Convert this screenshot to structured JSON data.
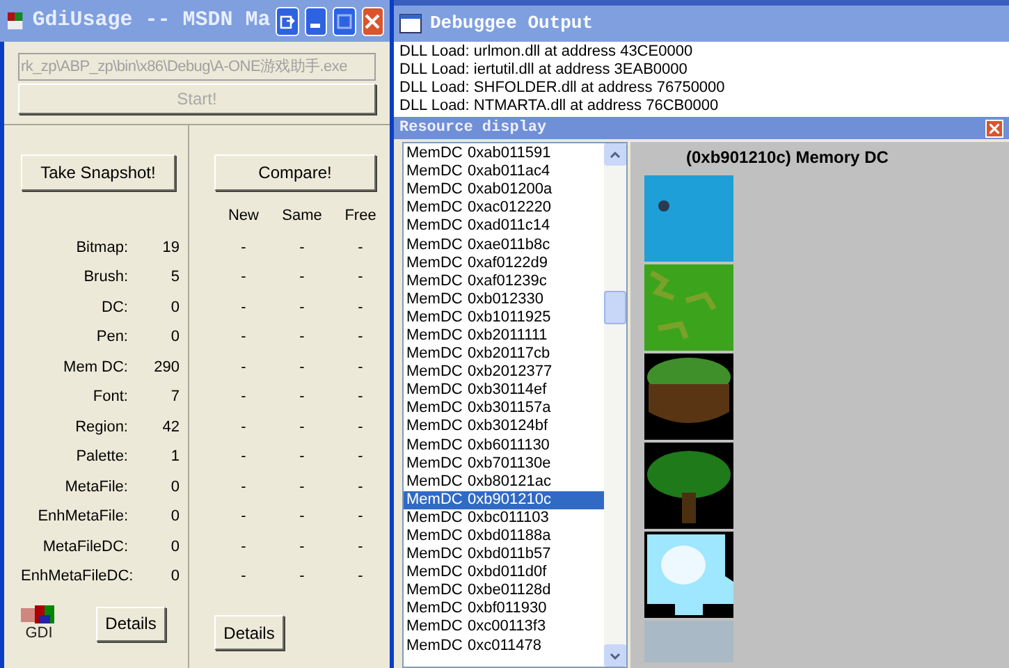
{
  "main_window": {
    "title": "GdiUsage -- MSDN Ma",
    "path_field": {
      "value": "rk_zp\\ABP_zp\\bin\\x86\\Debug\\A-ONE游戏助手.exe",
      "disabled": true
    },
    "start_button": {
      "label": "Start!",
      "disabled": true
    },
    "snapshot_button": "Take Snapshot!",
    "compare_button": "Compare!",
    "columns": [
      "New",
      "Same",
      "Free"
    ],
    "rows": [
      {
        "label": "Bitmap:",
        "count": "19",
        "new": "-",
        "same": "-",
        "free": "-"
      },
      {
        "label": "Brush:",
        "count": "5",
        "new": "-",
        "same": "-",
        "free": "-"
      },
      {
        "label": "DC:",
        "count": "0",
        "new": "-",
        "same": "-",
        "free": "-"
      },
      {
        "label": "Pen:",
        "count": "0",
        "new": "-",
        "same": "-",
        "free": "-"
      },
      {
        "label": "Mem DC:",
        "count": "290",
        "new": "-",
        "same": "-",
        "free": "-"
      },
      {
        "label": "Font:",
        "count": "7",
        "new": "-",
        "same": "-",
        "free": "-"
      },
      {
        "label": "Region:",
        "count": "42",
        "new": "-",
        "same": "-",
        "free": "-"
      },
      {
        "label": "Palette:",
        "count": "1",
        "new": "-",
        "same": "-",
        "free": "-"
      },
      {
        "label": "MetaFile:",
        "count": "0",
        "new": "-",
        "same": "-",
        "free": "-"
      },
      {
        "label": "EnhMetaFile:",
        "count": "0",
        "new": "-",
        "same": "-",
        "free": "-"
      },
      {
        "label": "MetaFileDC:",
        "count": "0",
        "new": "-",
        "same": "-",
        "free": "-"
      },
      {
        "label": "EnhMetaFileDC:",
        "count": "0",
        "new": "-",
        "same": "-",
        "free": "-"
      }
    ],
    "logo_label": "GDI",
    "details_left": "Details",
    "details_right": "Details"
  },
  "debug_window": {
    "title": "Debuggee Output",
    "lines": [
      "DLL Load: urlmon.dll at address 43CE0000",
      "DLL Load: iertutil.dll at address 3EAB0000",
      "DLL Load: SHFOLDER.dll at address 76750000",
      "DLL Load: NTMARTA.dll at address 76CB0000"
    ]
  },
  "resource_window": {
    "title": "Resource display",
    "preview_title": "(0xb901210c) Memory DC",
    "items": [
      {
        "type": "MemDC",
        "handle": "0xab011591",
        "selected": false
      },
      {
        "type": "MemDC",
        "handle": "0xab011ac4",
        "selected": false
      },
      {
        "type": "MemDC",
        "handle": "0xab01200a",
        "selected": false
      },
      {
        "type": "MemDC",
        "handle": "0xac012220",
        "selected": false
      },
      {
        "type": "MemDC",
        "handle": "0xad011c14",
        "selected": false
      },
      {
        "type": "MemDC",
        "handle": "0xae011b8c",
        "selected": false
      },
      {
        "type": "MemDC",
        "handle": "0xaf0122d9",
        "selected": false
      },
      {
        "type": "MemDC",
        "handle": "0xaf01239c",
        "selected": false
      },
      {
        "type": "MemDC",
        "handle": "0xb012330",
        "selected": false
      },
      {
        "type": "MemDC",
        "handle": "0xb1011925",
        "selected": false
      },
      {
        "type": "MemDC",
        "handle": "0xb2011111",
        "selected": false
      },
      {
        "type": "MemDC",
        "handle": "0xb20117cb",
        "selected": false
      },
      {
        "type": "MemDC",
        "handle": "0xb2012377",
        "selected": false
      },
      {
        "type": "MemDC",
        "handle": "0xb30114ef",
        "selected": false
      },
      {
        "type": "MemDC",
        "handle": "0xb301157a",
        "selected": false
      },
      {
        "type": "MemDC",
        "handle": "0xb30124bf",
        "selected": false
      },
      {
        "type": "MemDC",
        "handle": "0xb6011130",
        "selected": false
      },
      {
        "type": "MemDC",
        "handle": "0xb701130e",
        "selected": false
      },
      {
        "type": "MemDC",
        "handle": "0xb80121ac",
        "selected": false
      },
      {
        "type": "MemDC",
        "handle": "0xb901210c",
        "selected": true
      },
      {
        "type": "MemDC",
        "handle": "0xbc011103",
        "selected": false
      },
      {
        "type": "MemDC",
        "handle": "0xbd01188a",
        "selected": false
      },
      {
        "type": "MemDC",
        "handle": "0xbd011b57",
        "selected": false
      },
      {
        "type": "MemDC",
        "handle": "0xbd011d0f",
        "selected": false
      },
      {
        "type": "MemDC",
        "handle": "0xbe01128d",
        "selected": false
      },
      {
        "type": "MemDC",
        "handle": "0xbf011930",
        "selected": false
      },
      {
        "type": "MemDC",
        "handle": "0xc00113f3",
        "selected": false
      },
      {
        "type": "MemDC",
        "handle": "0xc011478",
        "selected": false
      }
    ]
  }
}
